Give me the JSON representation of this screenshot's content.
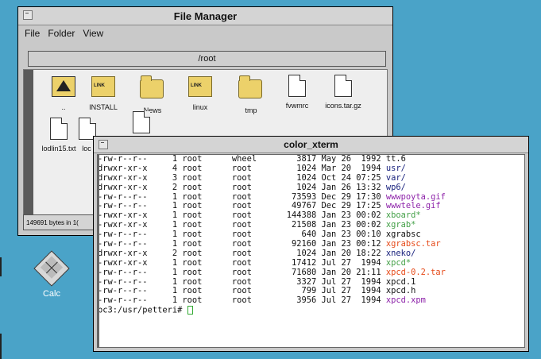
{
  "file_manager": {
    "title": "File Manager",
    "menu": [
      "File",
      "Folder",
      "View"
    ],
    "path": "/root",
    "files": [
      {
        "name": "..",
        "kind": "updir"
      },
      {
        "name": "INSTALL",
        "kind": "link"
      },
      {
        "name": "News",
        "kind": "folder"
      },
      {
        "name": "linux",
        "kind": "link"
      },
      {
        "name": "tmp",
        "kind": "folder"
      },
      {
        "name": "fvwmrc",
        "kind": "doc"
      },
      {
        "name": "icons.tar.gz",
        "kind": "doc"
      },
      {
        "name": "lodlin15.txt",
        "kind": "doc"
      },
      {
        "name": "loc",
        "kind": "doc"
      },
      {
        "name": "",
        "kind": "doc"
      }
    ],
    "status": "149691 bytes in 1("
  },
  "desktop": {
    "calc_label": "Calc",
    "calc_icon": "calculator-icon"
  },
  "xterm": {
    "title": "color_xterm",
    "lines": [
      {
        "perm": "-rw-r--r--",
        "links": "1",
        "owner": "root",
        "group": "wheel",
        "size": "3817",
        "date": "May 26  1992",
        "name": "tt.6",
        "color": "#111111"
      },
      {
        "perm": "drwxr-xr-x",
        "links": "4",
        "owner": "root",
        "group": "root",
        "size": "1024",
        "date": "Mar 20  1994",
        "name": "usr/",
        "color": "#1a237e"
      },
      {
        "perm": "drwxr-xr-x",
        "links": "3",
        "owner": "root",
        "group": "root",
        "size": "1024",
        "date": "Oct 24 07:25",
        "name": "var/",
        "color": "#1a237e"
      },
      {
        "perm": "drwxr-xr-x",
        "links": "2",
        "owner": "root",
        "group": "root",
        "size": "1024",
        "date": "Jan 26 13:32",
        "name": "wp6/",
        "color": "#1a237e"
      },
      {
        "perm": "-rw-r--r--",
        "links": "1",
        "owner": "root",
        "group": "root",
        "size": "73593",
        "date": "Dec 29 17:30",
        "name": "wwwpoyta.gif",
        "color": "#8e24aa"
      },
      {
        "perm": "-rw-r--r--",
        "links": "1",
        "owner": "root",
        "group": "root",
        "size": "49767",
        "date": "Dec 29 17:25",
        "name": "wwwtele.gif",
        "color": "#8e24aa"
      },
      {
        "perm": "-rwxr-xr-x",
        "links": "1",
        "owner": "root",
        "group": "root",
        "size": "144388",
        "date": "Jan 23 00:02",
        "name": "xboard*",
        "color": "#43a047"
      },
      {
        "perm": "-rwxr-xr-x",
        "links": "1",
        "owner": "root",
        "group": "root",
        "size": "21508",
        "date": "Jan 23 00:02",
        "name": "xgrab*",
        "color": "#43a047"
      },
      {
        "perm": "-rw-r--r--",
        "links": "1",
        "owner": "root",
        "group": "root",
        "size": "640",
        "date": "Jan 23 00:10",
        "name": "xgrabsc",
        "color": "#111111"
      },
      {
        "perm": "-rw-r--r--",
        "links": "1",
        "owner": "root",
        "group": "root",
        "size": "92160",
        "date": "Jan 23 00:12",
        "name": "xgrabsc.tar",
        "color": "#e64a19"
      },
      {
        "perm": "drwxr-xr-x",
        "links": "2",
        "owner": "root",
        "group": "root",
        "size": "1024",
        "date": "Jan 20 18:22",
        "name": "xneko/",
        "color": "#1a237e"
      },
      {
        "perm": "-rwxr-xr-x",
        "links": "1",
        "owner": "root",
        "group": "root",
        "size": "17412",
        "date": "Jul 27  1994",
        "name": "xpcd*",
        "color": "#43a047"
      },
      {
        "perm": "-rw-r--r--",
        "links": "1",
        "owner": "root",
        "group": "root",
        "size": "71680",
        "date": "Jan 20 21:11",
        "name": "xpcd-0.2.tar",
        "color": "#e64a19"
      },
      {
        "perm": "-rw-r--r--",
        "links": "1",
        "owner": "root",
        "group": "root",
        "size": "3327",
        "date": "Jul 27  1994",
        "name": "xpcd.1",
        "color": "#111111"
      },
      {
        "perm": "-rw-r--r--",
        "links": "1",
        "owner": "root",
        "group": "root",
        "size": "799",
        "date": "Jul 27  1994",
        "name": "xpcd.h",
        "color": "#111111"
      },
      {
        "perm": "-rw-r--r--",
        "links": "1",
        "owner": "root",
        "group": "root",
        "size": "3956",
        "date": "Jul 27  1994",
        "name": "xpcd.xpm",
        "color": "#8e24aa"
      }
    ],
    "prompt": "pc3:/usr/petteri# "
  },
  "colors": {
    "desktop": "#4aa3c8",
    "folder": "#ecd16a"
  }
}
